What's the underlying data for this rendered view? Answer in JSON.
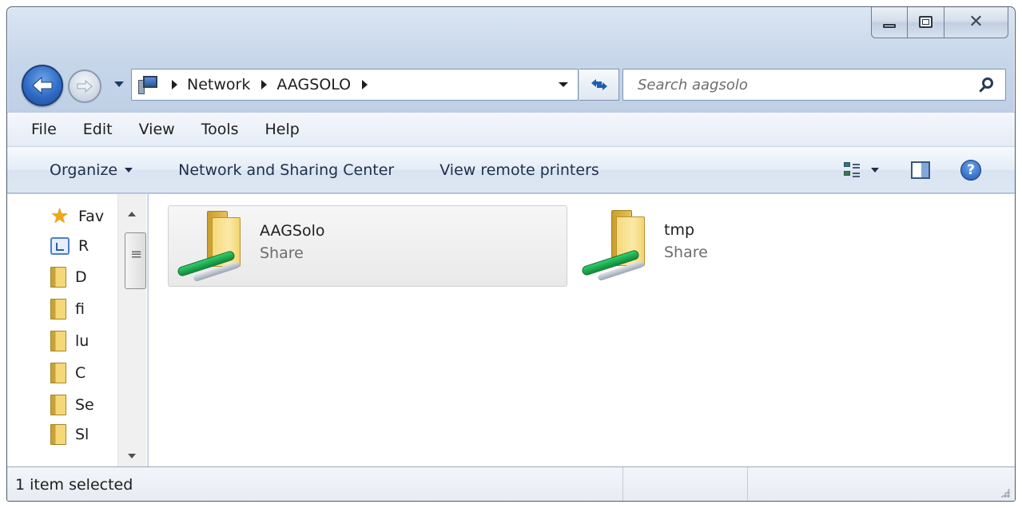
{
  "window": {
    "caption_buttons": [
      "minimize",
      "maximize",
      "close"
    ]
  },
  "navigation": {
    "breadcrumbs": [
      "Network",
      "AAGSOLO"
    ],
    "search_placeholder": "Search aagsolo"
  },
  "menu": {
    "items": [
      "File",
      "Edit",
      "View",
      "Tools",
      "Help"
    ]
  },
  "command_bar": {
    "organize": "Organize",
    "network_sharing": "Network and Sharing Center",
    "view_printers": "View remote printers"
  },
  "nav_pane": {
    "items": [
      {
        "label": "Fav",
        "icon": "star-icon"
      },
      {
        "label": "R",
        "icon": "recent-places-icon"
      },
      {
        "label": "D",
        "icon": "folder-icon"
      },
      {
        "label": "fi",
        "icon": "folder-icon"
      },
      {
        "label": "lu",
        "icon": "folder-icon"
      },
      {
        "label": "C",
        "icon": "folder-icon"
      },
      {
        "label": "Se",
        "icon": "folder-icon"
      },
      {
        "label": "Sl",
        "icon": "folder-icon"
      }
    ]
  },
  "shares": [
    {
      "name": "AAGSolo",
      "type": "Share",
      "selected": true
    },
    {
      "name": "tmp",
      "type": "Share",
      "selected": false
    }
  ],
  "status": {
    "text": "1 item selected"
  }
}
